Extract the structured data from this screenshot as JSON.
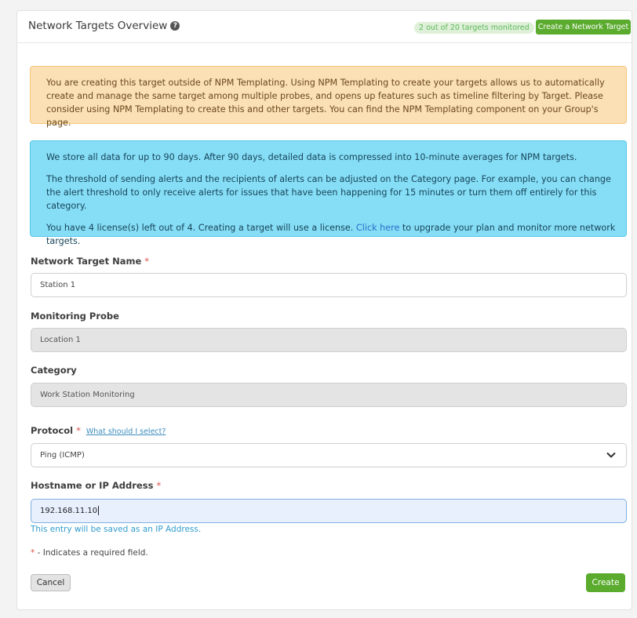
{
  "header": {
    "title": "Network Targets Overview",
    "monitored_badge": "2 out of 20 targets monitored",
    "create_button": "Create a Network Target"
  },
  "warning": {
    "text": "You are creating this target outside of NPM Templating. Using NPM Templating to create your targets allows us to automatically create and manage the same target among multiple probes, and opens up features such as timeline filtering by Target. Please consider using NPM Templating to create this and other targets. You can find the NPM Templating component on your Group's page."
  },
  "info": {
    "p1": "We store all data for up to 90 days. After 90 days, detailed data is compressed into 10-minute averages for NPM targets.",
    "p2": "The threshold of sending alerts and the recipients of alerts can be adjusted on the Category page. For example, you can change the alert threshold to only receive alerts for issues that have been happening for 15 minutes or turn them off entirely for this category.",
    "p3_before": "You have 4 license(s) left out of 4. Creating a target will use a license.",
    "p3_link": "Click here",
    "p3_after": "to upgrade your plan and monitor more network targets."
  },
  "form": {
    "name_label": "Network Target Name",
    "name_value": "Station 1",
    "probe_label": "Monitoring Probe",
    "probe_value": "Location 1",
    "category_label": "Category",
    "category_value": "Work Station Monitoring",
    "protocol_label": "Protocol",
    "protocol_help": "What should I select?",
    "protocol_value": "Ping (ICMP)",
    "host_label": "Hostname or IP Address",
    "host_value": "192.168.11.10",
    "host_hint": "This entry will be saved as an IP Address.",
    "required_star": "*",
    "required_note": "- Indicates a required field.",
    "cancel": "Cancel",
    "create": "Create"
  }
}
